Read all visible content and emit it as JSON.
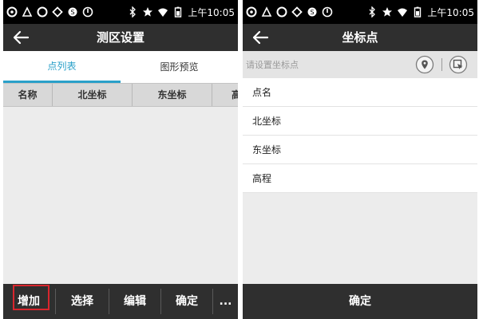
{
  "status_bar": {
    "time": "上午10:05",
    "left_icons": [
      "notification-icon",
      "notification-icon",
      "notification-icon",
      "notification-icon",
      "notification-icon",
      "notification-icon"
    ],
    "right_icons": [
      "bluetooth-icon",
      "star-icon",
      "wifi-icon",
      "battery-icon"
    ]
  },
  "left_screen": {
    "title": "测区设置",
    "tabs": [
      {
        "label": "点列表",
        "active": true
      },
      {
        "label": "图形预览",
        "active": false
      }
    ],
    "table_columns": [
      "名称",
      "北坐标",
      "东坐标",
      "高"
    ],
    "bottom_buttons": [
      {
        "label": "增加",
        "highlighted": true
      },
      {
        "label": "选择"
      },
      {
        "label": "编辑"
      },
      {
        "label": "确定"
      },
      {
        "label": "..."
      }
    ]
  },
  "right_screen": {
    "title": "坐标点",
    "search": {
      "placeholder": "请设置坐标点",
      "value": ""
    },
    "fields": [
      {
        "label": "点名"
      },
      {
        "label": "北坐标"
      },
      {
        "label": "东坐标"
      },
      {
        "label": "高程"
      }
    ],
    "confirm_label": "确定"
  },
  "colors": {
    "accent": "#2aa0c9",
    "bar": "#2f2f2f",
    "highlight": "#d8262d"
  }
}
